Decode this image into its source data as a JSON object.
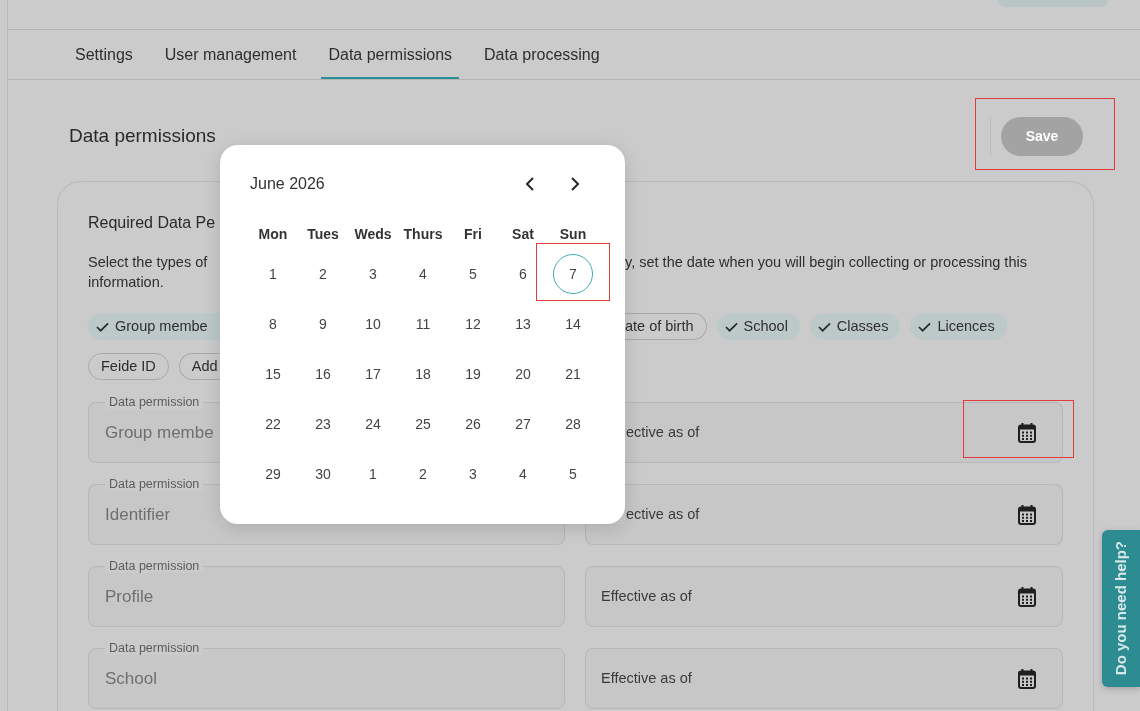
{
  "tabs": [
    {
      "label": "Settings",
      "selected": false
    },
    {
      "label": "User management",
      "selected": false
    },
    {
      "label": "Data permissions",
      "selected": true
    },
    {
      "label": "Data processing",
      "selected": false
    }
  ],
  "heading": "Data permissions",
  "save": {
    "label": "Save",
    "disabled": true,
    "highlighted": true
  },
  "card": {
    "title": "Required Data Pe",
    "description_lines": [
      {
        "left": "Select the types of",
        "right": "y, set the date when you will begin collecting or processing this"
      },
      {
        "left": "information."
      }
    ],
    "chip_rows": [
      {
        "left": [
          {
            "label": "Group membe",
            "selected": true
          }
        ],
        "right": [
          {
            "label": "ate of birth",
            "selected": false
          },
          {
            "label": "School",
            "selected": true
          },
          {
            "label": "Classes",
            "selected": true
          },
          {
            "label": "Licences",
            "selected": true
          }
        ]
      },
      {
        "left": [
          {
            "label": "Feide ID",
            "selected": false
          },
          {
            "label": "Add",
            "selected": false
          }
        ]
      }
    ],
    "permission_rows": [
      {
        "permission": {
          "label": "Data permission",
          "value": "Group membe"
        },
        "effective": {
          "placeholder": "ective as of",
          "highlighted": true
        }
      },
      {
        "permission": {
          "label": "Data permission",
          "value": "Identifier"
        },
        "effective": {
          "placeholder": "ective as of",
          "highlighted": false
        }
      },
      {
        "permission": {
          "label": "Data permission",
          "value": "Profile"
        },
        "effective": {
          "placeholder": "Effective as of",
          "highlighted": false
        }
      },
      {
        "permission": {
          "label": "Data permission",
          "value": "School"
        },
        "effective": {
          "placeholder": "Effective as of",
          "highlighted": false
        }
      }
    ]
  },
  "date_picker": {
    "month": "June 2026",
    "weekdays": [
      "Mon",
      "Tues",
      "Weds",
      "Thurs",
      "Fri",
      "Sat",
      "Sun"
    ],
    "weeks": [
      [
        {
          "day": "1",
          "selected": false,
          "highlighted": false
        },
        {
          "day": "2",
          "selected": false,
          "highlighted": false
        },
        {
          "day": "3",
          "selected": false,
          "highlighted": false
        },
        {
          "day": "4",
          "selected": false,
          "highlighted": false
        },
        {
          "day": "5",
          "selected": false,
          "highlighted": false
        },
        {
          "day": "6",
          "selected": false,
          "highlighted": false
        },
        {
          "day": "7",
          "selected": true,
          "highlighted": true
        }
      ],
      [
        {
          "day": "8",
          "selected": false,
          "highlighted": false
        },
        {
          "day": "9",
          "selected": false,
          "highlighted": false
        },
        {
          "day": "10",
          "selected": false,
          "highlighted": false
        },
        {
          "day": "11",
          "selected": false,
          "highlighted": false
        },
        {
          "day": "12",
          "selected": false,
          "highlighted": false
        },
        {
          "day": "13",
          "selected": false,
          "highlighted": false
        },
        {
          "day": "14",
          "selected": false,
          "highlighted": false
        }
      ],
      [
        {
          "day": "15",
          "selected": false,
          "highlighted": false
        },
        {
          "day": "16",
          "selected": false,
          "highlighted": false
        },
        {
          "day": "17",
          "selected": false,
          "highlighted": false
        },
        {
          "day": "18",
          "selected": false,
          "highlighted": false
        },
        {
          "day": "19",
          "selected": false,
          "highlighted": false
        },
        {
          "day": "20",
          "selected": false,
          "highlighted": false
        },
        {
          "day": "21",
          "selected": false,
          "highlighted": false
        }
      ],
      [
        {
          "day": "22",
          "selected": false,
          "highlighted": false
        },
        {
          "day": "23",
          "selected": false,
          "highlighted": false
        },
        {
          "day": "24",
          "selected": false,
          "highlighted": false
        },
        {
          "day": "25",
          "selected": false,
          "highlighted": false
        },
        {
          "day": "26",
          "selected": false,
          "highlighted": false
        },
        {
          "day": "27",
          "selected": false,
          "highlighted": false
        },
        {
          "day": "28",
          "selected": false,
          "highlighted": false
        }
      ],
      [
        {
          "day": "29",
          "selected": false,
          "highlighted": false
        },
        {
          "day": "30",
          "selected": false,
          "highlighted": false
        },
        {
          "day": "1",
          "selected": false,
          "highlighted": false
        },
        {
          "day": "2",
          "selected": false,
          "highlighted": false
        },
        {
          "day": "3",
          "selected": false,
          "highlighted": false
        },
        {
          "day": "4",
          "selected": false,
          "highlighted": false
        },
        {
          "day": "5",
          "selected": false,
          "highlighted": false
        }
      ]
    ]
  },
  "help_tab": {
    "label": "Do you need help?"
  }
}
